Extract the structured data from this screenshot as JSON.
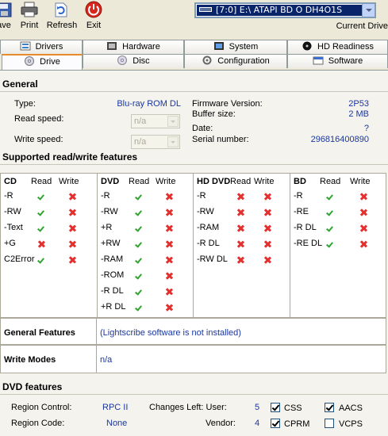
{
  "toolbar": {
    "buttons": [
      {
        "label": "ave",
        "icon": "save-icon"
      },
      {
        "label": "Print",
        "icon": "printer-icon"
      },
      {
        "label": "Refresh",
        "icon": "refresh-icon"
      },
      {
        "label": "Exit",
        "icon": "exit-icon"
      }
    ],
    "drive_select": "[7:0] E:\\ ATAPI   BD  O  DH4O1S",
    "current_drive_label": "Current Drive"
  },
  "tabs": {
    "row1": [
      {
        "label": "Drivers",
        "icon": "drivers-icon"
      },
      {
        "label": "Hardware",
        "icon": "hardware-icon"
      },
      {
        "label": "System",
        "icon": "system-icon"
      },
      {
        "label": "HD Readiness",
        "icon": "hd-readiness-icon"
      }
    ],
    "row2": [
      {
        "label": "Drive",
        "icon": "drive-icon",
        "active": true
      },
      {
        "label": "Disc",
        "icon": "disc-icon"
      },
      {
        "label": "Configuration",
        "icon": "configuration-icon"
      },
      {
        "label": "Software",
        "icon": "software-icon"
      }
    ]
  },
  "general": {
    "heading": "General",
    "type_label": "Type:",
    "type_value": "Blu-ray ROM DL",
    "read_speed_label": "Read speed:",
    "read_speed_value": "n/a",
    "write_speed_label": "Write speed:",
    "write_speed_value": "n/a",
    "firmware_label": "Firmware Version:",
    "firmware_value": "2P53",
    "buffer_label": "Buffer size:",
    "buffer_value": "2 MB",
    "date_label": "Date:",
    "date_value": "?",
    "serial_label": "Serial number:",
    "serial_value": "296816400890"
  },
  "features": {
    "heading": "Supported read/write features",
    "read_label": "Read",
    "write_label": "Write",
    "columns": [
      {
        "title": "CD",
        "rows": [
          {
            "name": "-R",
            "read": true,
            "write": false
          },
          {
            "name": "-RW",
            "read": true,
            "write": false
          },
          {
            "name": "-Text",
            "read": true,
            "write": false
          },
          {
            "name": "+G",
            "read": false,
            "write": false
          },
          {
            "name": "C2Error",
            "read": true,
            "write": false
          }
        ]
      },
      {
        "title": "DVD",
        "rows": [
          {
            "name": "-R",
            "read": true,
            "write": false
          },
          {
            "name": "-RW",
            "read": true,
            "write": false
          },
          {
            "name": "+R",
            "read": true,
            "write": false
          },
          {
            "name": "+RW",
            "read": true,
            "write": false
          },
          {
            "name": "-RAM",
            "read": true,
            "write": false
          },
          {
            "name": "-ROM",
            "read": true,
            "write": false
          },
          {
            "name": "-R DL",
            "read": true,
            "write": false
          },
          {
            "name": "+R DL",
            "read": true,
            "write": false
          }
        ]
      },
      {
        "title": "HD DVD",
        "rows": [
          {
            "name": "-R",
            "read": false,
            "write": false
          },
          {
            "name": "-RW",
            "read": false,
            "write": false
          },
          {
            "name": "-RAM",
            "read": false,
            "write": false
          },
          {
            "name": "-R DL",
            "read": false,
            "write": false
          },
          {
            "name": "-RW DL",
            "read": false,
            "write": false
          }
        ]
      },
      {
        "title": "BD",
        "rows": [
          {
            "name": "-R",
            "read": true,
            "write": false
          },
          {
            "name": "-RE",
            "read": true,
            "write": false
          },
          {
            "name": "-R DL",
            "read": true,
            "write": false
          },
          {
            "name": "-RE DL",
            "read": true,
            "write": false
          }
        ]
      }
    ]
  },
  "general_features": {
    "label": "General Features",
    "value": "(Lightscribe software is not installed)"
  },
  "write_modes": {
    "label": "Write Modes",
    "value": "n/a"
  },
  "dvd_features": {
    "heading": "DVD features",
    "region_control_label": "Region Control:",
    "region_control_value": "RPC II",
    "region_code_label": "Region Code:",
    "region_code_value": "None",
    "changes_user_label": "Changes Left: User:",
    "changes_user_value": "5",
    "vendor_label": "Vendor:",
    "vendor_value": "4",
    "checks": [
      {
        "label": "CSS",
        "checked": true
      },
      {
        "label": "AACS",
        "checked": true
      },
      {
        "label": "CPRM",
        "checked": true
      },
      {
        "label": "VCPS",
        "checked": false
      }
    ]
  },
  "colors": {
    "accent_blue": "#1a37a0",
    "ok_green": "#2fa52f",
    "no_red": "#e3302f",
    "tab_highlight": "#e68b2c"
  }
}
